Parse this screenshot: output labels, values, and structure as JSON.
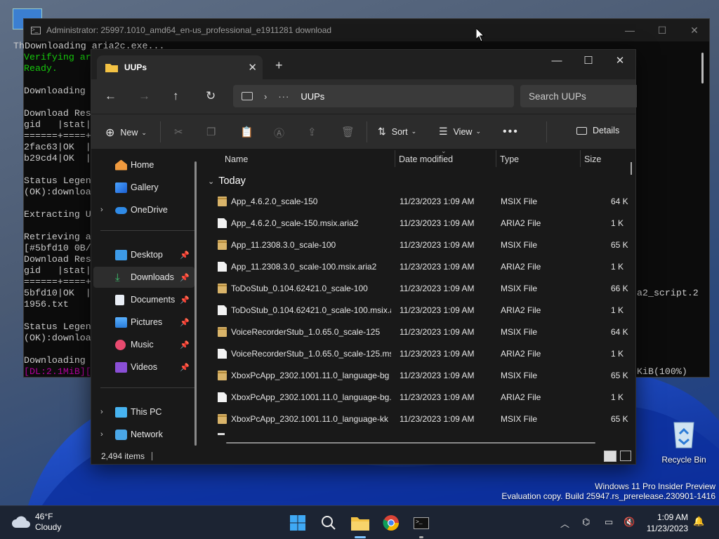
{
  "desktop": {
    "recycle_bin_label": "Recycle Bin",
    "watermark_line1": "Windows 11 Pro Insider Preview",
    "watermark_line2": "Evaluation copy. Build 25947.rs_prerelease.230901-1416"
  },
  "terminal": {
    "title": "Administrator:  25997.1010_amd64_en-us_professional_e1911281 download",
    "lines": [
      {
        "text": "ThDownloading aria2c.exe...",
        "color": "#cccccc"
      },
      {
        "text": "Verifying ar",
        "color": "#16c60c"
      },
      {
        "text": "Ready.",
        "color": "#16c60c"
      },
      {
        "text": "",
        "color": "#cccccc"
      },
      {
        "text": "Downloading ",
        "color": "#cccccc"
      },
      {
        "text": "",
        "color": "#cccccc"
      },
      {
        "text": "Download Res",
        "color": "#cccccc"
      },
      {
        "text": "gid   |stat|",
        "color": "#cccccc"
      },
      {
        "text": "======+====+",
        "color": "#cccccc"
      },
      {
        "text": "2fac63|OK  |",
        "color": "#cccccc"
      },
      {
        "text": "b29cd4|OK  |",
        "color": "#cccccc"
      },
      {
        "text": "",
        "color": "#cccccc"
      },
      {
        "text": "Status Legen",
        "color": "#cccccc"
      },
      {
        "text": "(OK):downloa",
        "color": "#cccccc"
      },
      {
        "text": "",
        "color": "#cccccc"
      },
      {
        "text": "Extracting U",
        "color": "#cccccc"
      },
      {
        "text": "",
        "color": "#cccccc"
      },
      {
        "text": "Retrieving a",
        "color": "#cccccc"
      },
      {
        "text": "[#5bfd10 0B/",
        "color": "#cccccc"
      },
      {
        "text": "Download Res",
        "color": "#cccccc"
      },
      {
        "text": "gid   |stat|",
        "color": "#cccccc"
      },
      {
        "text": "======+====+",
        "color": "#cccccc"
      },
      {
        "text": "5bfd10|OK  |",
        "color": "#cccccc"
      },
      {
        "text": "1956.txt",
        "color": "#cccccc"
      },
      {
        "text": "",
        "color": "#cccccc"
      },
      {
        "text": "Status Legen",
        "color": "#cccccc"
      },
      {
        "text": "(OK):downloa",
        "color": "#cccccc"
      },
      {
        "text": "",
        "color": "#cccccc"
      },
      {
        "text": "Downloading ",
        "color": "#cccccc"
      },
      {
        "text": "[DL:2.1MiB][",
        "color": "#b4009e"
      }
    ],
    "right_line1": "a2_script.2",
    "right_line2": "KiB(100%)"
  },
  "explorer": {
    "tab_title": "UUPs",
    "address": "UUPs",
    "search_placeholder": "Search UUPs",
    "toolbar": {
      "new_label": "New",
      "sort_label": "Sort",
      "view_label": "View",
      "details_label": "Details"
    },
    "nav": {
      "home": "Home",
      "gallery": "Gallery",
      "onedrive": "OneDrive",
      "desktop": "Desktop",
      "downloads": "Downloads",
      "documents": "Documents",
      "pictures": "Pictures",
      "music": "Music",
      "videos": "Videos",
      "this_pc": "This PC",
      "network": "Network"
    },
    "columns": {
      "name": "Name",
      "date": "Date modified",
      "type": "Type",
      "size": "Size"
    },
    "group_label": "Today",
    "files": [
      {
        "name": "App_4.6.2.0_scale-150",
        "date": "11/23/2023 1:09 AM",
        "type": "MSIX File",
        "size": "64 K",
        "icon": "package"
      },
      {
        "name": "App_4.6.2.0_scale-150.msix.aria2",
        "date": "11/23/2023 1:09 AM",
        "type": "ARIA2 File",
        "size": "1 K",
        "icon": "file"
      },
      {
        "name": "App_11.2308.3.0_scale-100",
        "date": "11/23/2023 1:09 AM",
        "type": "MSIX File",
        "size": "65 K",
        "icon": "package"
      },
      {
        "name": "App_11.2308.3.0_scale-100.msix.aria2",
        "date": "11/23/2023 1:09 AM",
        "type": "ARIA2 File",
        "size": "1 K",
        "icon": "file"
      },
      {
        "name": "ToDoStub_0.104.62421.0_scale-100",
        "date": "11/23/2023 1:09 AM",
        "type": "MSIX File",
        "size": "66 K",
        "icon": "package"
      },
      {
        "name": "ToDoStub_0.104.62421.0_scale-100.msix.a...",
        "date": "11/23/2023 1:09 AM",
        "type": "ARIA2 File",
        "size": "1 K",
        "icon": "file"
      },
      {
        "name": "VoiceRecorderStub_1.0.65.0_scale-125",
        "date": "11/23/2023 1:09 AM",
        "type": "MSIX File",
        "size": "64 K",
        "icon": "package"
      },
      {
        "name": "VoiceRecorderStub_1.0.65.0_scale-125.ms...",
        "date": "11/23/2023 1:09 AM",
        "type": "ARIA2 File",
        "size": "1 K",
        "icon": "file"
      },
      {
        "name": "XboxPcApp_2302.1001.11.0_language-bg",
        "date": "11/23/2023 1:09 AM",
        "type": "MSIX File",
        "size": "65 K",
        "icon": "package"
      },
      {
        "name": "XboxPcApp_2302.1001.11.0_language-bg....",
        "date": "11/23/2023 1:09 AM",
        "type": "ARIA2 File",
        "size": "1 K",
        "icon": "file"
      },
      {
        "name": "XboxPcApp_2302.1001.11.0_language-kk",
        "date": "11/23/2023 1:09 AM",
        "type": "MSIX File",
        "size": "65 K",
        "icon": "package"
      }
    ],
    "status_count": "2,494 items"
  },
  "taskbar": {
    "weather_temp": "46°F",
    "weather_desc": "Cloudy",
    "time": "1:09 AM",
    "date": "11/23/2023"
  }
}
